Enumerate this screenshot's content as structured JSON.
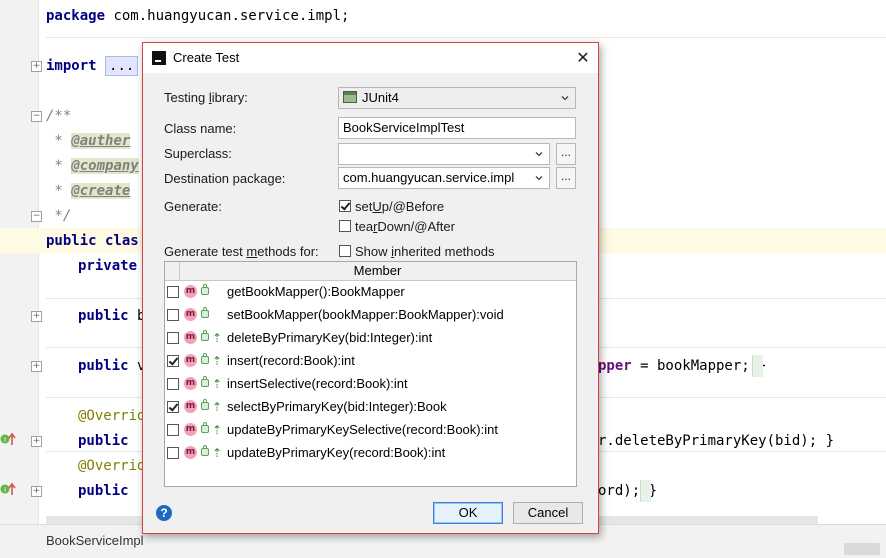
{
  "editor": {
    "file_tab": "BookServiceImpl",
    "lines": {
      "l1_kw": "package",
      "l1_rest": " com.huangyucan.service.impl;",
      "l2_kw": "import",
      "l2_fold": "...",
      "l3": "/**",
      "l4_star": " * ",
      "l4_tag": "@auther",
      "l5_star": " * ",
      "l5_tag": "@company",
      "l6_star": " * ",
      "l6_tag": "@create",
      "l7": " */",
      "l8_kw": "public",
      "l8_rest": " clas",
      "l9_kw": "private",
      "l10_kw": "public",
      "l10_rest": " b",
      "l11_kw": "public",
      "l11_rest": " v",
      "l11_tail_field": "pper",
      "l11_tail_rest": " = bookMapper; }",
      "l12_ann": "@Overrid",
      "l13_kw": "public",
      "l13_tail": "r.deleteByPrimaryKey(bid); }",
      "l14_ann": "@Overrid",
      "l15_kw": "public",
      "l15_tail": "ord); }"
    }
  },
  "dialog": {
    "title": "Create Test",
    "close_glyph": "✕",
    "testing_library_label": "Testing library:",
    "testing_library_value": "JUnit4",
    "class_name_label": "Class name:",
    "class_name_value": "BookServiceImplTest",
    "superclass_label": "Superclass:",
    "superclass_value": "",
    "destination_package_label": "Destination package:",
    "destination_package_value": "com.huangyucan.service.impl",
    "browse_label": "...",
    "generate_label": "Generate:",
    "setup_label": "setUp/@Before",
    "setup_checked": true,
    "teardown_label": "tearDown/@After",
    "teardown_checked": false,
    "methods_label": "Generate test methods for:",
    "show_inherited_label": "Show inherited methods",
    "show_inherited_checked": false,
    "table_header": "Member",
    "members": [
      {
        "name": "getBookMapper():BookMapper",
        "checked": false,
        "override": false
      },
      {
        "name": "setBookMapper(bookMapper:BookMapper):void",
        "checked": false,
        "override": false
      },
      {
        "name": "deleteByPrimaryKey(bid:Integer):int",
        "checked": false,
        "override": true
      },
      {
        "name": "insert(record:Book):int",
        "checked": true,
        "override": true
      },
      {
        "name": "insertSelective(record:Book):int",
        "checked": false,
        "override": true
      },
      {
        "name": "selectByPrimaryKey(bid:Integer):Book",
        "checked": true,
        "override": true
      },
      {
        "name": "updateByPrimaryKeySelective(record:Book):int",
        "checked": false,
        "override": true
      },
      {
        "name": "updateByPrimaryKey(record:Book):int",
        "checked": false,
        "override": true
      }
    ],
    "method_icon_letter": "m",
    "override_glyph": "⇡",
    "help_glyph": "?",
    "ok_label": "OK",
    "cancel_label": "Cancel"
  }
}
